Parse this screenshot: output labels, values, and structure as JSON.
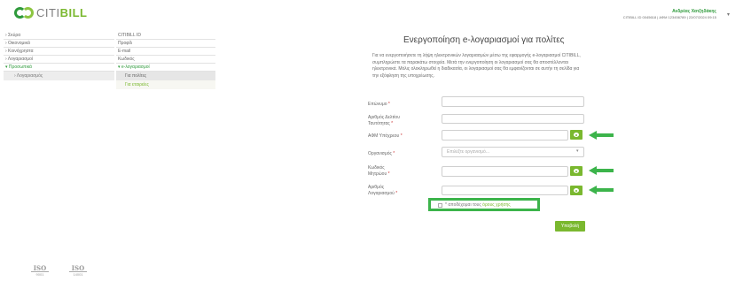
{
  "header": {
    "logo_prefix": "CITI",
    "logo_bold": "BILL",
    "user_name": "Ανδρέας Χατζηδάκης",
    "user_meta": "CITIBILL ID 0045618 | ΑΦΜ 123456789 | 22/07/2024 09:15",
    "dropdown_glyph": "▾"
  },
  "sidebar": {
    "items": [
      {
        "label": "› Σκύρα"
      },
      {
        "label": "› Οικονομικά"
      },
      {
        "label": "› Κοινόχρηστα"
      },
      {
        "label": "› Λογαριασμοί"
      },
      {
        "label": "▾ Προσωπικά",
        "active": true
      }
    ],
    "sub_item": "› Λογαριασμός"
  },
  "subnav": {
    "items": [
      {
        "label": "CITIBILL ID"
      },
      {
        "label": "Προφίλ"
      },
      {
        "label": "E-mail"
      },
      {
        "label": "Κωδικός"
      },
      {
        "label": "▾ e-λογαριασμοί",
        "active": true
      }
    ],
    "subs": [
      {
        "label": "Για πολίτες",
        "selected": true
      },
      {
        "label": "Για εταιρείες",
        "selected": false
      }
    ]
  },
  "iso": [
    {
      "title": "ISO",
      "number": "9001"
    },
    {
      "title": "ISO",
      "number": "14001"
    }
  ],
  "form": {
    "title": "Ενεργοποίηση e-λογαριασμοί για πολίτες",
    "intro": "Για να ενεργοποιήσετε τη λήψη ηλεκτρονικών λογαριασμών μέσω της εφαρμογής e-λογαριασμοί CITIBILL, συμπληρώστε τα παρακάτω στοιχεία. Μετά την ενεργοποίηση οι λογαριασμοί σας θα αποστέλλονται ηλεκτρονικά. Μόλις ολοκληρωθεί η διαδικασία, οι λογαριασμοί σας θα εμφανίζονται σε αυτήν τη σελίδα για την εξόφληση της υποχρέωσης.",
    "fields": [
      {
        "label": "Επώνυμο",
        "required": "*",
        "value": ""
      },
      {
        "label": "Αριθμός Δελτίου Ταυτότητας",
        "required": "*",
        "value": ""
      },
      {
        "label": "ΑΦΜ Υπόχρεου",
        "required": "*",
        "value": ""
      },
      {
        "label": "Οργανισμός",
        "required": "*",
        "placeholder": "Επιλέξτε οργανισμό..."
      },
      {
        "label": "Κωδικός Μητρώου",
        "required": "*",
        "value": ""
      },
      {
        "label": "Αριθμός Λογαριασμού",
        "required": "*",
        "value": ""
      }
    ],
    "select_caret": "▾",
    "terms_prefix": "* αποδέχομαι τους ",
    "terms_link": "όρους χρήσης",
    "submit_label": "Υποβολή"
  },
  "colors": {
    "brand_green": "#7ab82f",
    "dark_green": "#2e9a3b",
    "highlight_green": "#3cb44b"
  }
}
